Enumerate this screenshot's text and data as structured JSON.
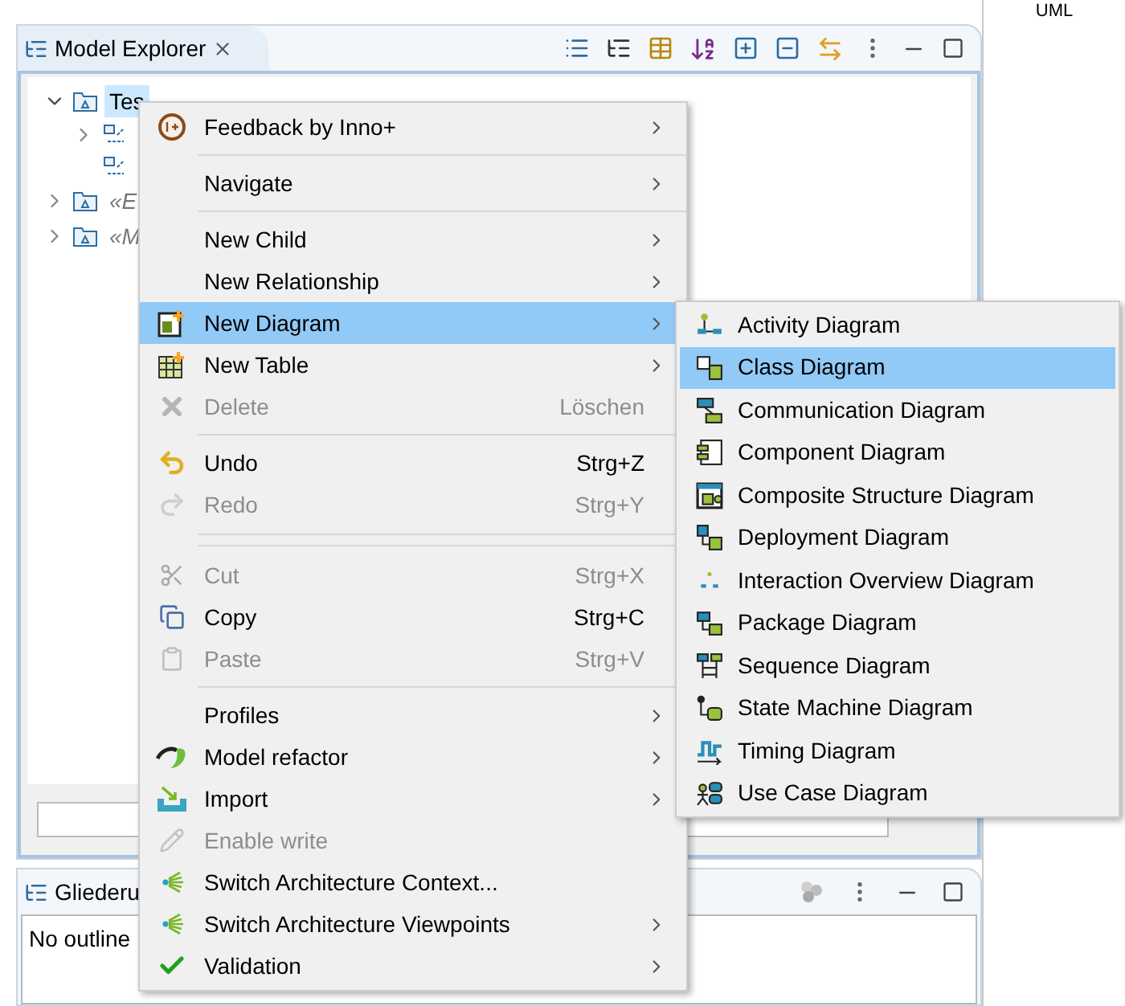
{
  "top_right_label": "UML",
  "explorer": {
    "tab_title": "Model Explorer",
    "tree": [
      {
        "label": "Tes",
        "selected": true,
        "expanded": true,
        "italic": false,
        "children": [
          {
            "expandable": true
          },
          {
            "expandable": false
          }
        ]
      },
      {
        "label": "«E",
        "selected": false,
        "expanded": false,
        "italic": true
      },
      {
        "label": "«M",
        "selected": false,
        "expanded": false,
        "italic": true
      }
    ]
  },
  "outline": {
    "tab_title": "Gliederu",
    "message": "No outline"
  },
  "context_menu": [
    {
      "kind": "item",
      "label": "Feedback by Inno+",
      "submenu": true,
      "disabled": false,
      "selected": false
    },
    {
      "kind": "separator"
    },
    {
      "kind": "item",
      "label": "Navigate",
      "submenu": true,
      "disabled": false,
      "selected": false
    },
    {
      "kind": "separator"
    },
    {
      "kind": "item",
      "label": "New Child",
      "submenu": true,
      "disabled": false,
      "selected": false
    },
    {
      "kind": "item",
      "label": "New Relationship",
      "submenu": true,
      "disabled": false,
      "selected": false
    },
    {
      "kind": "item",
      "label": "New Diagram",
      "submenu": true,
      "disabled": false,
      "selected": true
    },
    {
      "kind": "item",
      "label": "New Table",
      "submenu": true,
      "disabled": false,
      "selected": false
    },
    {
      "kind": "item",
      "label": "Delete",
      "shortcut": "Löschen",
      "submenu": false,
      "disabled": true,
      "selected": false
    },
    {
      "kind": "separator"
    },
    {
      "kind": "item",
      "label": "Undo",
      "shortcut": "Strg+Z",
      "submenu": false,
      "disabled": false,
      "selected": false
    },
    {
      "kind": "item",
      "label": "Redo",
      "shortcut": "Strg+Y",
      "submenu": false,
      "disabled": true,
      "selected": false
    },
    {
      "kind": "double_separator"
    },
    {
      "kind": "item",
      "label": "Cut",
      "shortcut": "Strg+X",
      "submenu": false,
      "disabled": true,
      "selected": false
    },
    {
      "kind": "item",
      "label": "Copy",
      "shortcut": "Strg+C",
      "submenu": false,
      "disabled": false,
      "selected": false
    },
    {
      "kind": "item",
      "label": "Paste",
      "shortcut": "Strg+V",
      "submenu": false,
      "disabled": true,
      "selected": false
    },
    {
      "kind": "separator"
    },
    {
      "kind": "item",
      "label": "Profiles",
      "submenu": true,
      "disabled": false,
      "selected": false
    },
    {
      "kind": "item",
      "label": "Model refactor",
      "submenu": true,
      "disabled": false,
      "selected": false
    },
    {
      "kind": "item",
      "label": "Import",
      "submenu": true,
      "disabled": false,
      "selected": false
    },
    {
      "kind": "item",
      "label": "Enable write",
      "submenu": false,
      "disabled": true,
      "selected": false
    },
    {
      "kind": "item",
      "label": "Switch Architecture Context...",
      "submenu": false,
      "disabled": false,
      "selected": false
    },
    {
      "kind": "item",
      "label": "Switch Architecture Viewpoints",
      "submenu": true,
      "disabled": false,
      "selected": false
    },
    {
      "kind": "item",
      "label": "Validation",
      "submenu": true,
      "disabled": false,
      "selected": false
    }
  ],
  "diagram_submenu": [
    {
      "label": "Activity Diagram",
      "selected": false
    },
    {
      "label": "Class Diagram",
      "selected": true
    },
    {
      "label": "Communication Diagram",
      "selected": false
    },
    {
      "label": "Component Diagram",
      "selected": false
    },
    {
      "label": "Composite Structure Diagram",
      "selected": false
    },
    {
      "label": "Deployment Diagram",
      "selected": false
    },
    {
      "label": "Interaction Overview Diagram",
      "selected": false
    },
    {
      "label": "Package Diagram",
      "selected": false
    },
    {
      "label": "Sequence Diagram",
      "selected": false
    },
    {
      "label": "State Machine Diagram",
      "selected": false
    },
    {
      "label": "Timing Diagram",
      "selected": false
    },
    {
      "label": "Use Case Diagram",
      "selected": false
    }
  ]
}
